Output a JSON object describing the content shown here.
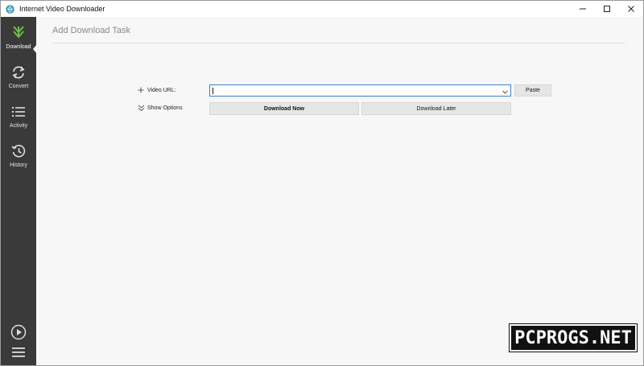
{
  "window": {
    "title": "Internet Video Downloader",
    "controls": [
      "minimize",
      "maximize",
      "close"
    ]
  },
  "sidebar": {
    "items": [
      {
        "label": "Download",
        "icon": "download-arrow-icon",
        "active": true
      },
      {
        "label": "Convert",
        "icon": "convert-icon",
        "active": false
      },
      {
        "label": "Activity",
        "icon": "list-icon",
        "active": false
      },
      {
        "label": "History",
        "icon": "history-clock-icon",
        "active": false
      }
    ],
    "bottom": [
      "play-circle-icon",
      "hamburger-menu-icon"
    ]
  },
  "main": {
    "title": "Add Download Task",
    "video_url_label": "Video URL:",
    "show_options_label": "Show Options",
    "url_value": "",
    "paste_label": "Paste",
    "download_now_label": "Download Now",
    "download_later_label": "Download Later"
  },
  "colors": {
    "sidebar_bg": "#3a3a3a",
    "accent_green": "#6cc04a",
    "focus_border": "#3b7fcf"
  },
  "watermark": "PCPROGS.NET"
}
